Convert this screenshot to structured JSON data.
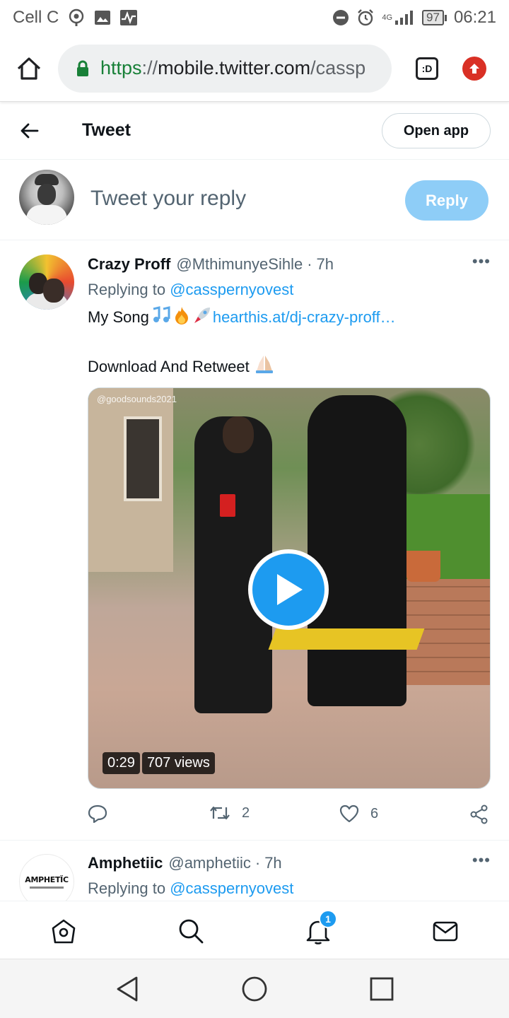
{
  "status_bar": {
    "carrier": "Cell C",
    "network": "4G",
    "battery": "97",
    "time": "06:21"
  },
  "browser": {
    "url_scheme": "https",
    "url_sep": "://",
    "url_host": "mobile.twitter.com",
    "url_path": "/cassp",
    "tab_label": ":D"
  },
  "header": {
    "title": "Tweet",
    "open_app": "Open app"
  },
  "reply_bar": {
    "placeholder": "Tweet your reply",
    "button": "Reply"
  },
  "tweets": [
    {
      "name": "Crazy Proff",
      "handle": "@MthimunyeSihle",
      "separator": "·",
      "time": "7h",
      "replying_prefix": "Replying to",
      "replying_to": "@casspernyovest",
      "text_line1": "My Song",
      "link": "hearthis.at/dj-crazy-proff…",
      "text_line2": "Download And Retweet",
      "media": {
        "watermark": "@goodsounds2021",
        "duration": "0:29",
        "views": "707 views"
      },
      "stats": {
        "retweets": "2",
        "likes": "6"
      }
    },
    {
      "name": "Amphetiic",
      "handle": "@amphetiic",
      "separator": "·",
      "time": "7h",
      "replying_prefix": "Replying to",
      "replying_to": "@casspernyovest",
      "avatar_logo": "AMPHETÏC"
    }
  ],
  "bottom_nav": {
    "notification_count": "1"
  },
  "colors": {
    "accent": "#1d9bf0",
    "reply_button": "#8ecdf7",
    "secure_scheme": "#188038",
    "update_badge": "#d93025"
  },
  "icons": [
    "home-outline-icon",
    "lock-icon",
    "tab-switcher-icon",
    "update-arrow-icon",
    "back-arrow-icon",
    "more-icon",
    "play-icon",
    "comment-icon",
    "retweet-icon",
    "like-icon",
    "share-icon",
    "home-icon",
    "search-icon",
    "bell-icon",
    "mail-icon",
    "back-triangle-icon",
    "home-circle-icon",
    "recents-square-icon"
  ]
}
